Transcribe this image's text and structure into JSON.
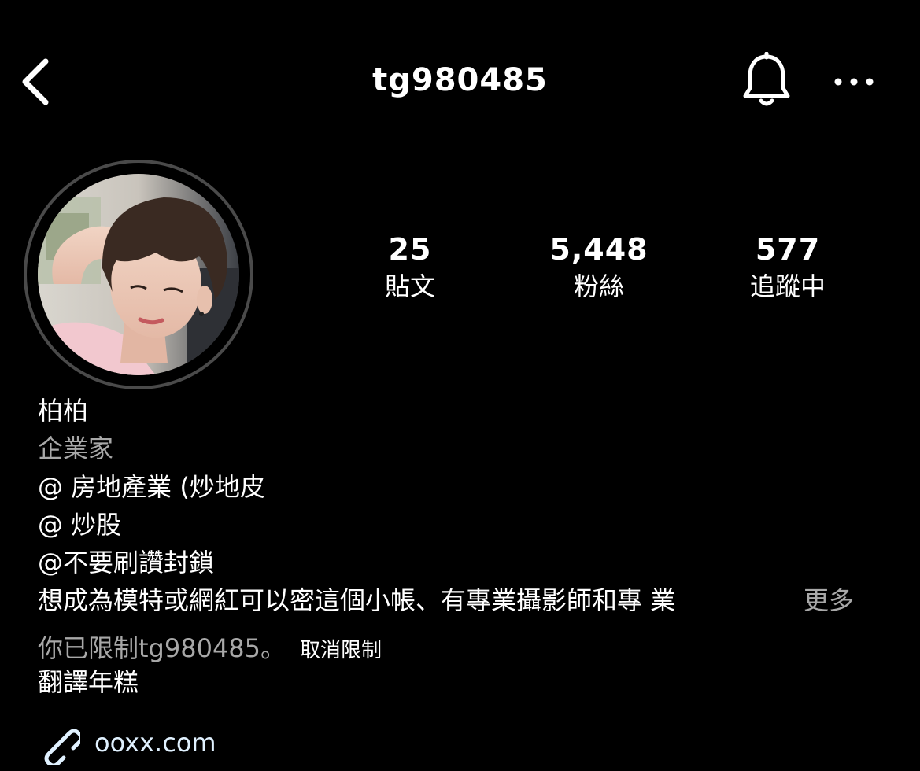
{
  "header": {
    "username": "tg980485",
    "back_icon": "chevron-left-icon",
    "bell_icon": "bell-icon",
    "more_icon": "more-horizontal-icon"
  },
  "profile": {
    "stats": {
      "posts": {
        "value": "25",
        "label": "貼文"
      },
      "followers": {
        "value": "5,448",
        "label": "粉絲"
      },
      "following": {
        "value": "577",
        "label": "追蹤中"
      }
    },
    "name": "柏柏",
    "category": "企業家",
    "bio_lines": [
      "@ 房地產業 (炒地皮",
      "@ 炒股",
      "@不要刷讚封鎖",
      "想成為模特或網紅可以密這個小帳、有專業攝影師和專 業"
    ],
    "more_label": "更多",
    "restricted_text": "你已限制tg980485。",
    "unrestrict_label": "取消限制",
    "translate_label": "翻譯年糕",
    "link": "ooxx.com",
    "link_icon": "link-icon"
  },
  "colors": {
    "background": "#000000",
    "text": "#ffffff",
    "secondary_text": "#a8a8a8",
    "link_text": "#e0f1ff",
    "avatar_ring": "#4a4a4a"
  }
}
